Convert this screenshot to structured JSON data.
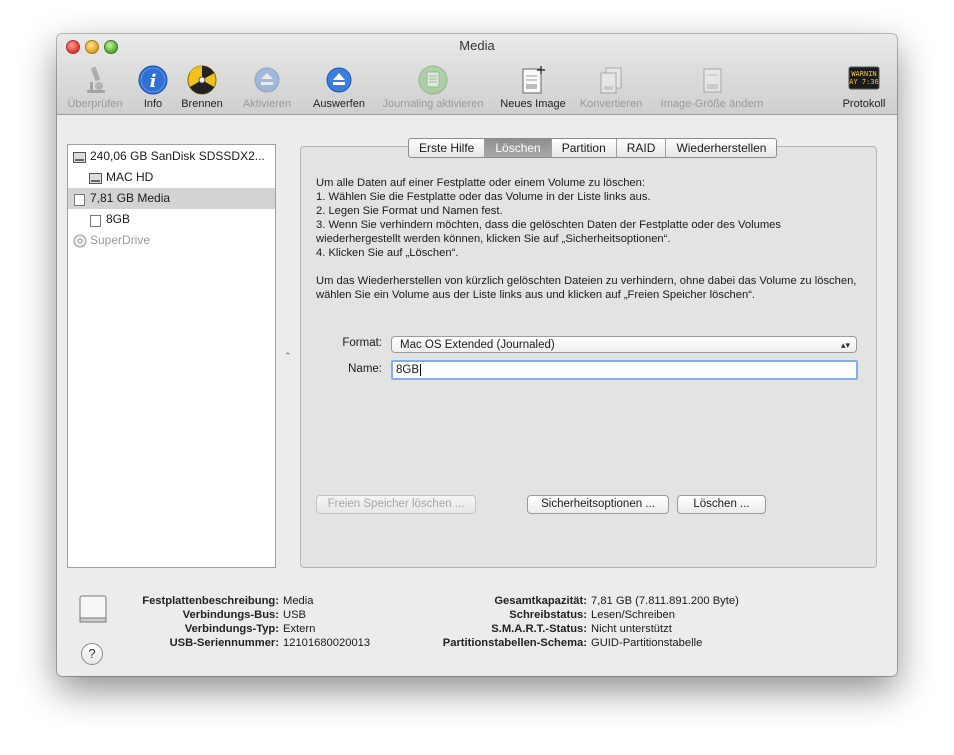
{
  "window": {
    "title": "Media"
  },
  "toolbar": {
    "items": [
      {
        "label": "Überprüfen",
        "icon": "microscope-icon",
        "enabled": false
      },
      {
        "label": "Info",
        "icon": "info-icon",
        "enabled": true
      },
      {
        "label": "Brennen",
        "icon": "burn-icon",
        "enabled": true
      },
      {
        "label": "Aktivieren",
        "icon": "mount-icon",
        "enabled": false
      },
      {
        "label": "Auswerfen",
        "icon": "eject-icon",
        "enabled": true
      },
      {
        "label": "Journaling aktivieren",
        "icon": "journaling-icon",
        "enabled": false
      },
      {
        "label": "Neues Image",
        "icon": "new-image-icon",
        "enabled": true
      },
      {
        "label": "Konvertieren",
        "icon": "convert-icon",
        "enabled": false
      },
      {
        "label": "Image-Größe ändern",
        "icon": "resize-image-icon",
        "enabled": false
      },
      {
        "label": "Protokoll",
        "icon": "log-icon",
        "enabled": true,
        "log_text": "WARNIN\n AY 7:36"
      }
    ]
  },
  "sidebar": {
    "items": [
      {
        "label": "240,06 GB SanDisk SDSSDX2...",
        "level": 0,
        "selected": false,
        "enabled": true
      },
      {
        "label": "MAC HD",
        "level": 1,
        "selected": false,
        "enabled": true
      },
      {
        "label": "7,81 GB Media",
        "level": 0,
        "selected": true,
        "enabled": true
      },
      {
        "label": "8GB",
        "level": 1,
        "selected": false,
        "enabled": true
      },
      {
        "label": "SuperDrive",
        "level": 0,
        "selected": false,
        "enabled": false
      }
    ]
  },
  "tabs": [
    {
      "label": "Erste Hilfe",
      "active": false
    },
    {
      "label": "Löschen",
      "active": true
    },
    {
      "label": "Partition",
      "active": false
    },
    {
      "label": "RAID",
      "active": false
    },
    {
      "label": "Wiederherstellen",
      "active": false
    }
  ],
  "erase": {
    "instructions": [
      "Um alle Daten auf einer Festplatte oder einem Volume zu löschen:",
      "1.     Wählen Sie die Festplatte oder das Volume in der Liste links aus.",
      "2.     Legen Sie Format und Namen fest.",
      "3.     Wenn Sie verhindern möchten, dass die gelöschten Daten der Festplatte oder des Volumes wiederhergestellt werden können, klicken Sie auf „Sicherheitsoptionen“.",
      "4.     Klicken Sie auf „Löschen“."
    ],
    "note": "Um das Wiederherstellen von kürzlich gelöschten Dateien zu verhindern, ohne dabei das Volume zu löschen, wählen Sie ein Volume aus der Liste links aus und klicken auf „Freien Speicher löschen“.",
    "format_label": "Format:",
    "format_value": "Mac OS Extended (Journaled)",
    "name_label": "Name:",
    "name_value": "8GB",
    "free_space_button": "Freien Speicher löschen ...",
    "security_button": "Sicherheitsoptionen ...",
    "erase_button": "Löschen ..."
  },
  "info": {
    "left": [
      {
        "key": "Festplattenbeschreibung:",
        "value": "Media"
      },
      {
        "key": "Verbindungs-Bus:",
        "value": "USB"
      },
      {
        "key": "Verbindungs-Typ:",
        "value": "Extern"
      },
      {
        "key": "USB-Seriennummer:",
        "value": "12101680020013"
      }
    ],
    "right": [
      {
        "key": "Gesamtkapazität:",
        "value": "7,81 GB (7.811.891.200 Byte)"
      },
      {
        "key": "Schreibstatus:",
        "value": "Lesen/Schreiben"
      },
      {
        "key": "S.M.A.R.T.-Status:",
        "value": "Nicht unterstützt"
      },
      {
        "key": "Partitionstabellen-Schema:",
        "value": "GUID-Partitionstabelle"
      }
    ],
    "help_label": "?"
  }
}
